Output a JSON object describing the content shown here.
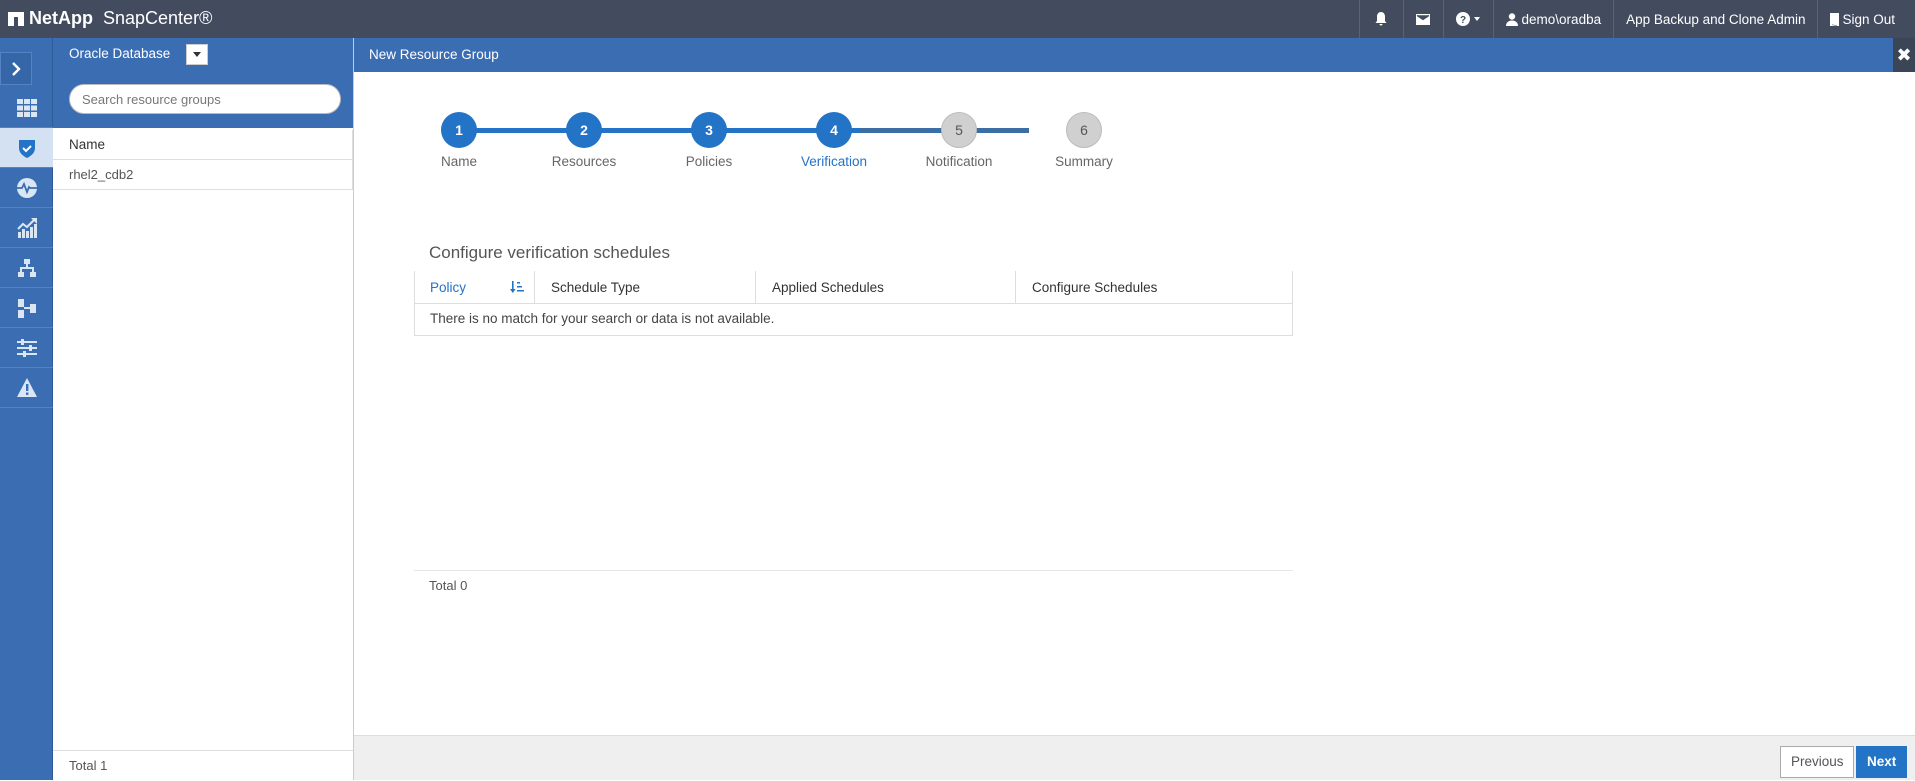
{
  "topbar": {
    "brand": "NetApp",
    "product": "SnapCenter®",
    "user": "demo\\oradba",
    "role": "App Backup and Clone Admin",
    "signout": "Sign Out",
    "icons": [
      "bell-icon",
      "mail-icon",
      "help-icon",
      "user-icon",
      "door-icon"
    ]
  },
  "rail": {
    "items": [
      {
        "icon": "dashboard-grid-icon",
        "active": false
      },
      {
        "icon": "resources-shield-icon",
        "active": true
      },
      {
        "icon": "monitor-pulse-icon",
        "active": false
      },
      {
        "icon": "reports-chart-icon",
        "active": false
      },
      {
        "icon": "hosts-hierarchy-icon",
        "active": false
      },
      {
        "icon": "storage-systems-icon",
        "active": false
      },
      {
        "icon": "settings-sliders-icon",
        "active": false
      },
      {
        "icon": "alerts-warning-icon",
        "active": false
      }
    ]
  },
  "listpanel": {
    "plugin": "Oracle Database",
    "search_placeholder": "Search resource groups",
    "column": "Name",
    "rows": [
      "rhel2_cdb2"
    ],
    "total": "Total 1"
  },
  "main": {
    "title": "New Resource Group",
    "close": "✖",
    "steps": [
      {
        "num": "1",
        "label": "Name",
        "state": "done"
      },
      {
        "num": "2",
        "label": "Resources",
        "state": "done"
      },
      {
        "num": "3",
        "label": "Policies",
        "state": "done"
      },
      {
        "num": "4",
        "label": "Verification",
        "state": "current"
      },
      {
        "num": "5",
        "label": "Notification",
        "state": "todo"
      },
      {
        "num": "6",
        "label": "Summary",
        "state": "todo"
      }
    ],
    "section_title": "Configure verification schedules",
    "columns": [
      "Policy",
      "Schedule Type",
      "Applied Schedules",
      "Configure Schedules"
    ],
    "empty_message": "There is no match for your search or data is not available.",
    "total": "Total 0",
    "previous": "Previous",
    "next": "Next"
  },
  "colors": {
    "topbar": "#434c5e",
    "accent": "#3b6db3",
    "step_done": "#2373c6",
    "step_todo": "#d0d0d0"
  }
}
